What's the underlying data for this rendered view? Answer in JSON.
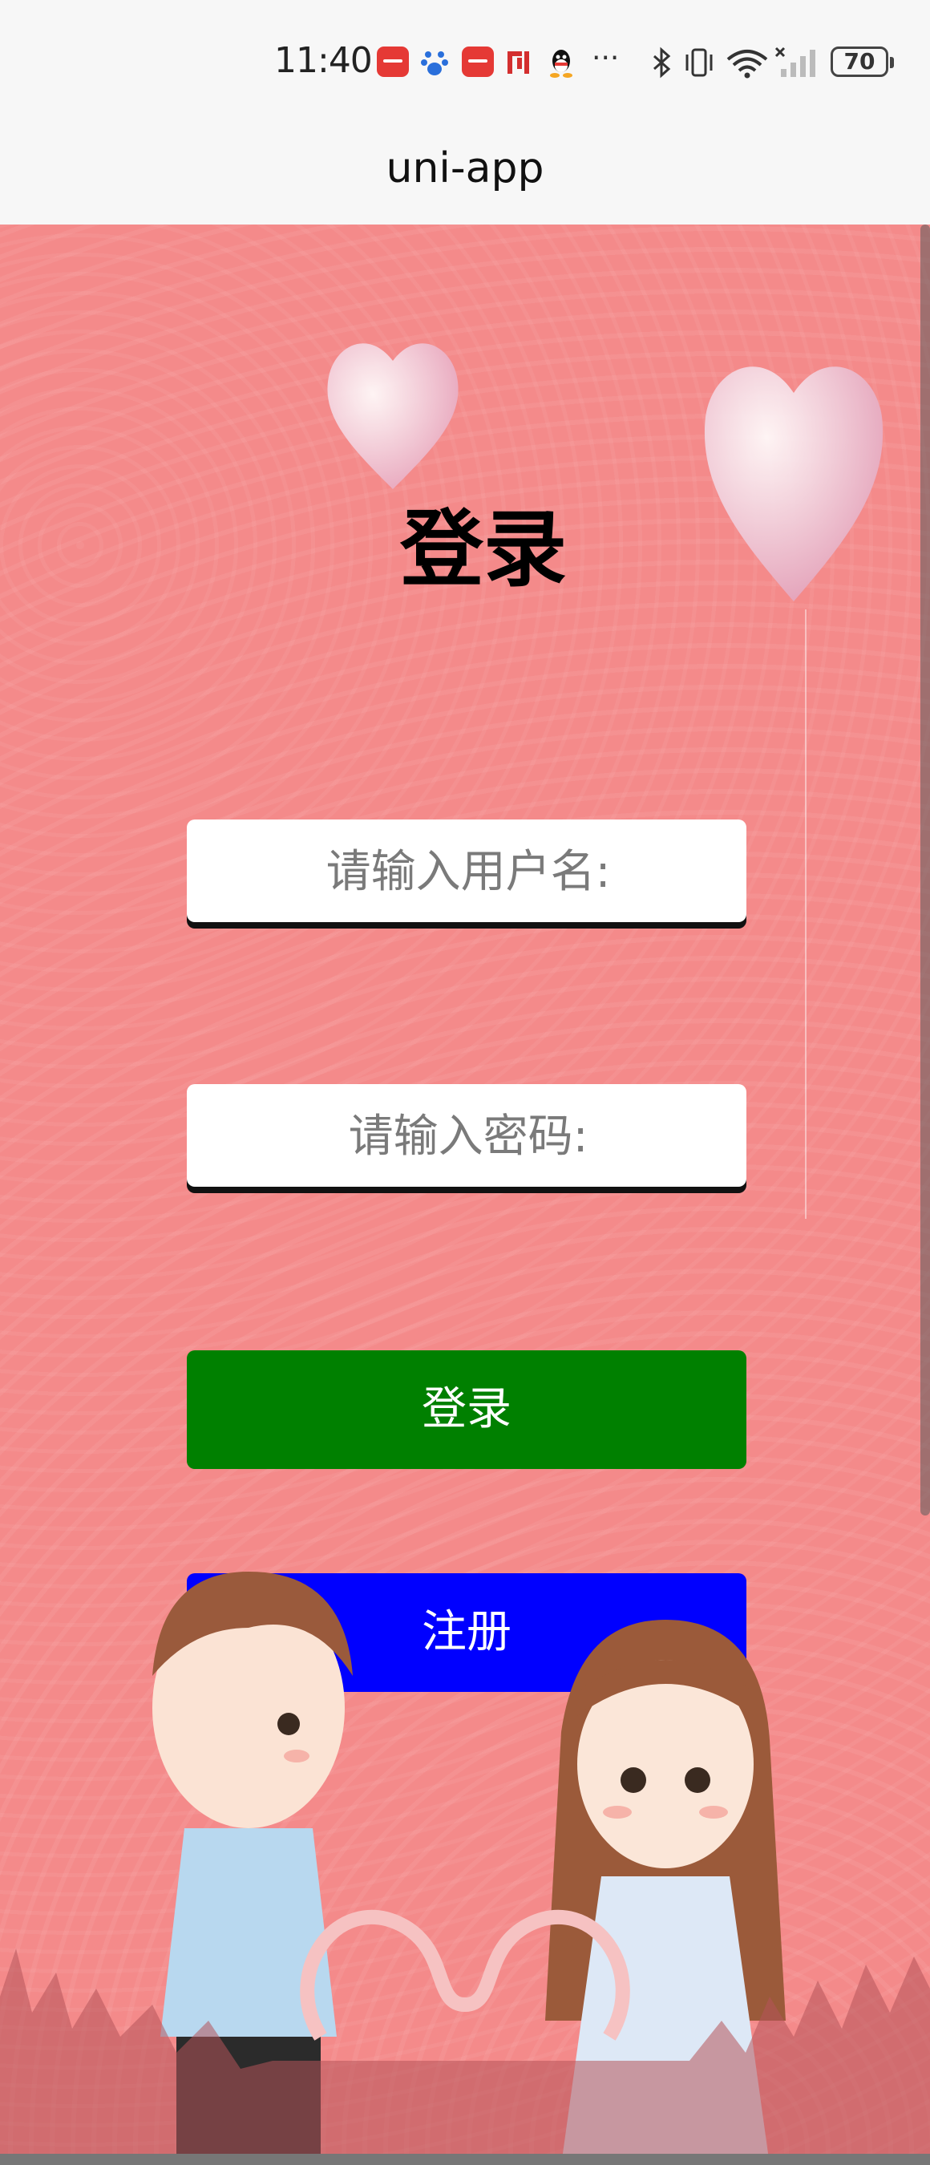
{
  "status_bar": {
    "time": "11:40",
    "battery": "70",
    "icons": [
      "huawei-appgallery-icon",
      "baidu-icon",
      "huawei-browser-icon",
      "post-icon",
      "qq-icon",
      "more-dots-icon",
      "bluetooth-icon",
      "vibrate-icon",
      "wifi-icon",
      "signal-icon",
      "battery-icon"
    ],
    "more": "···"
  },
  "nav": {
    "title": "uni-app"
  },
  "page": {
    "title": "登录",
    "username_placeholder": "请输入用户名:",
    "password_placeholder": "请输入密码:",
    "login_label": "登录",
    "register_label": "注册"
  },
  "colors": {
    "background": "#f48a8a",
    "login_button": "#008000",
    "register_button": "#0000ff"
  }
}
